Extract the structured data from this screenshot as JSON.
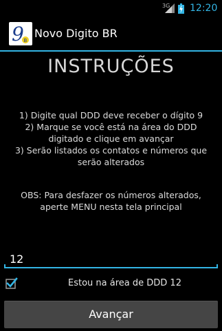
{
  "status_bar": {
    "network": "3G",
    "time": "12:20"
  },
  "action_bar": {
    "title": "Novo Digito BR",
    "icon": "app-logo-9-icon",
    "icon_label": "9"
  },
  "main": {
    "heading": "INSTRUÇÕES",
    "instructions": [
      "1) Digite qual DDD deve receber o dígito 9",
      "2) Marque se você está na área do DDD",
      "digitado e clique em avançar",
      "3) Serão listados os contatos e números que",
      "serão alterados"
    ],
    "obs": [
      "OBS: Para desfazer os números alterados,",
      "aperte MENU nesta tela principal"
    ],
    "ddd_value": "12",
    "checkbox_checked": true,
    "checkbox_label": "Estou na área de DDD 12",
    "button_label": "Avançar"
  },
  "colors": {
    "accent": "#33b5e5",
    "background": "#000000",
    "button": "#454545"
  }
}
